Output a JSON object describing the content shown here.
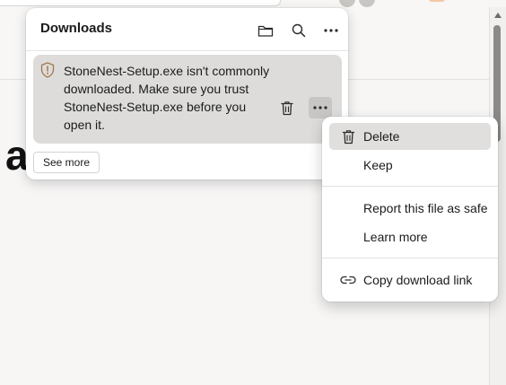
{
  "background": {
    "partial_heading_letter": "a"
  },
  "downloads_panel": {
    "title": "Downloads",
    "header_icons": [
      "folder-icon",
      "search-icon",
      "more-options-icon"
    ],
    "item": {
      "warning_text": "StoneNest-Setup.exe isn't commonly downloaded. Make sure you trust StoneNest-Setup.exe before you open it.",
      "icons": [
        "warning-shield-icon",
        "trash-icon",
        "more-options-icon"
      ]
    },
    "see_more_label": "See more"
  },
  "context_menu": {
    "items": [
      {
        "label": "Delete",
        "icon": "trash-icon"
      },
      {
        "label": "Keep"
      },
      {
        "label": "Report this file as safe"
      },
      {
        "label": "Learn more"
      },
      {
        "label": "Copy download link",
        "icon": "link-icon"
      }
    ]
  },
  "colors": {
    "panel_bg": "#ffffff",
    "card_bg": "#dddcdb",
    "warning_icon": "#a07a4a",
    "menu_highlight": "#e0dfde"
  }
}
